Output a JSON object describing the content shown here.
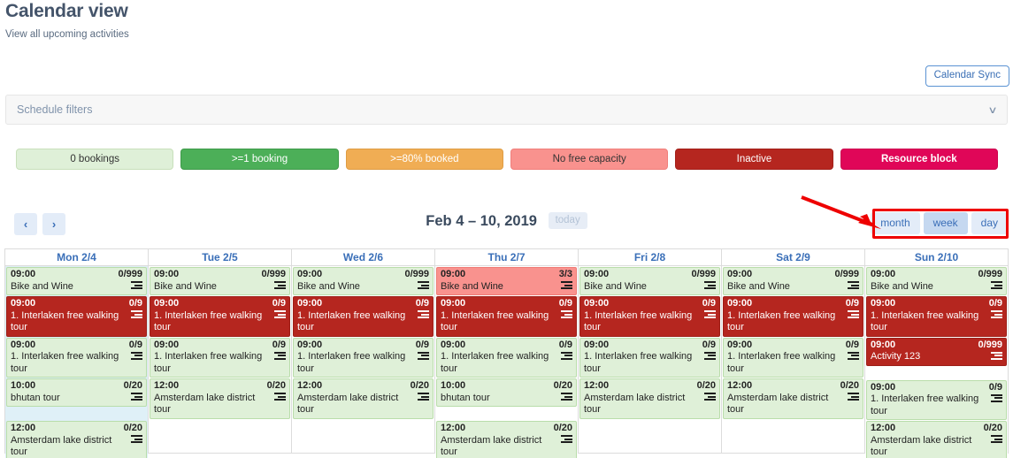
{
  "header": {
    "title": "Calendar view",
    "subtitle": "View all upcoming activities",
    "calendar_sync_label": "Calendar Sync"
  },
  "filters": {
    "label": "Schedule filters",
    "chevron": "∨"
  },
  "legend": {
    "items": [
      {
        "label": "0 bookings",
        "style": "lg-0",
        "color": "#dff0d8"
      },
      {
        "label": ">=1 booking",
        "style": "lg-1",
        "color": "#4caf58"
      },
      {
        "label": ">=80% booked",
        "style": "lg-80",
        "color": "#f0ad54"
      },
      {
        "label": "No free capacity",
        "style": "lg-nofree",
        "color": "#f9928e"
      },
      {
        "label": "Inactive",
        "style": "lg-inact",
        "color": "#b5261f"
      },
      {
        "label": "Resource block",
        "style": "lg-block",
        "color": "#e00658"
      }
    ]
  },
  "nav": {
    "prev_label": "‹",
    "next_label": "›",
    "range_title": "Feb 4 – 10, 2019",
    "today_label": "today",
    "views": [
      {
        "label": "month",
        "active": false
      },
      {
        "label": "week",
        "active": true
      },
      {
        "label": "day",
        "active": false
      }
    ]
  },
  "annotation": {
    "arrow_color": "#ee0000",
    "box_color": "#ee0000"
  },
  "calendar": {
    "columns": [
      {
        "header": "Mon 2/4",
        "highlight": true,
        "events": [
          {
            "time": "09:00",
            "capacity": "0/999",
            "title": "Bike and Wine",
            "state": "green"
          },
          {
            "time": "09:00",
            "capacity": "0/9",
            "title": "1. Interlaken free walking tour",
            "state": "red"
          },
          {
            "time": "09:00",
            "capacity": "0/9",
            "title": "1. Interlaken free walking tour",
            "state": "green"
          },
          {
            "time": "10:00",
            "capacity": "0/20",
            "title": "bhutan tour",
            "state": "green"
          },
          {
            "time": "12:00",
            "capacity": "0/20",
            "title": "Amsterdam lake district tour",
            "state": "green",
            "gap_before": true
          }
        ]
      },
      {
        "header": "Tue 2/5",
        "highlight": false,
        "events": [
          {
            "time": "09:00",
            "capacity": "0/999",
            "title": "Bike and Wine",
            "state": "green"
          },
          {
            "time": "09:00",
            "capacity": "0/9",
            "title": "1. Interlaken free walking tour",
            "state": "red"
          },
          {
            "time": "09:00",
            "capacity": "0/9",
            "title": "1. Interlaken free walking tour",
            "state": "green"
          },
          {
            "time": "12:00",
            "capacity": "0/20",
            "title": "Amsterdam lake district tour",
            "state": "green"
          }
        ]
      },
      {
        "header": "Wed 2/6",
        "highlight": false,
        "events": [
          {
            "time": "09:00",
            "capacity": "0/999",
            "title": "Bike and Wine",
            "state": "green"
          },
          {
            "time": "09:00",
            "capacity": "0/9",
            "title": "1. Interlaken free walking tour",
            "state": "red"
          },
          {
            "time": "09:00",
            "capacity": "0/9",
            "title": "1. Interlaken free walking tour",
            "state": "green"
          },
          {
            "time": "12:00",
            "capacity": "0/20",
            "title": "Amsterdam lake district tour",
            "state": "green"
          }
        ]
      },
      {
        "header": "Thu 2/7",
        "highlight": false,
        "events": [
          {
            "time": "09:00",
            "capacity": "3/3",
            "title": "Bike and Wine",
            "state": "pink"
          },
          {
            "time": "09:00",
            "capacity": "0/9",
            "title": "1. Interlaken free walking tour",
            "state": "red"
          },
          {
            "time": "09:00",
            "capacity": "0/9",
            "title": "1. Interlaken free walking tour",
            "state": "green"
          },
          {
            "time": "10:00",
            "capacity": "0/20",
            "title": "bhutan tour",
            "state": "green"
          },
          {
            "time": "12:00",
            "capacity": "0/20",
            "title": "Amsterdam lake district tour",
            "state": "green",
            "gap_before": true
          }
        ]
      },
      {
        "header": "Fri 2/8",
        "highlight": false,
        "events": [
          {
            "time": "09:00",
            "capacity": "0/999",
            "title": "Bike and Wine",
            "state": "green"
          },
          {
            "time": "09:00",
            "capacity": "0/9",
            "title": "1. Interlaken free walking tour",
            "state": "red"
          },
          {
            "time": "09:00",
            "capacity": "0/9",
            "title": "1. Interlaken free walking tour",
            "state": "green"
          },
          {
            "time": "12:00",
            "capacity": "0/20",
            "title": "Amsterdam lake district tour",
            "state": "green"
          }
        ]
      },
      {
        "header": "Sat 2/9",
        "highlight": false,
        "events": [
          {
            "time": "09:00",
            "capacity": "0/999",
            "title": "Bike and Wine",
            "state": "green"
          },
          {
            "time": "09:00",
            "capacity": "0/9",
            "title": "1. Interlaken free walking tour",
            "state": "red"
          },
          {
            "time": "09:00",
            "capacity": "0/9",
            "title": "1. Interlaken free walking tour",
            "state": "green"
          },
          {
            "time": "12:00",
            "capacity": "0/20",
            "title": "Amsterdam lake district tour",
            "state": "green"
          }
        ]
      },
      {
        "header": "Sun 2/10",
        "highlight": false,
        "events": [
          {
            "time": "09:00",
            "capacity": "0/999",
            "title": "Bike and Wine",
            "state": "green"
          },
          {
            "time": "09:00",
            "capacity": "0/9",
            "title": "1. Interlaken free walking tour",
            "state": "red"
          },
          {
            "time": "09:00",
            "capacity": "0/999",
            "title": "Activity 123",
            "state": "red"
          },
          {
            "time": "09:00",
            "capacity": "0/9",
            "title": "1. Interlaken free walking tour",
            "state": "green",
            "gap_before": true
          },
          {
            "time": "12:00",
            "capacity": "0/20",
            "title": "Amsterdam lake district tour",
            "state": "green"
          }
        ]
      }
    ]
  }
}
